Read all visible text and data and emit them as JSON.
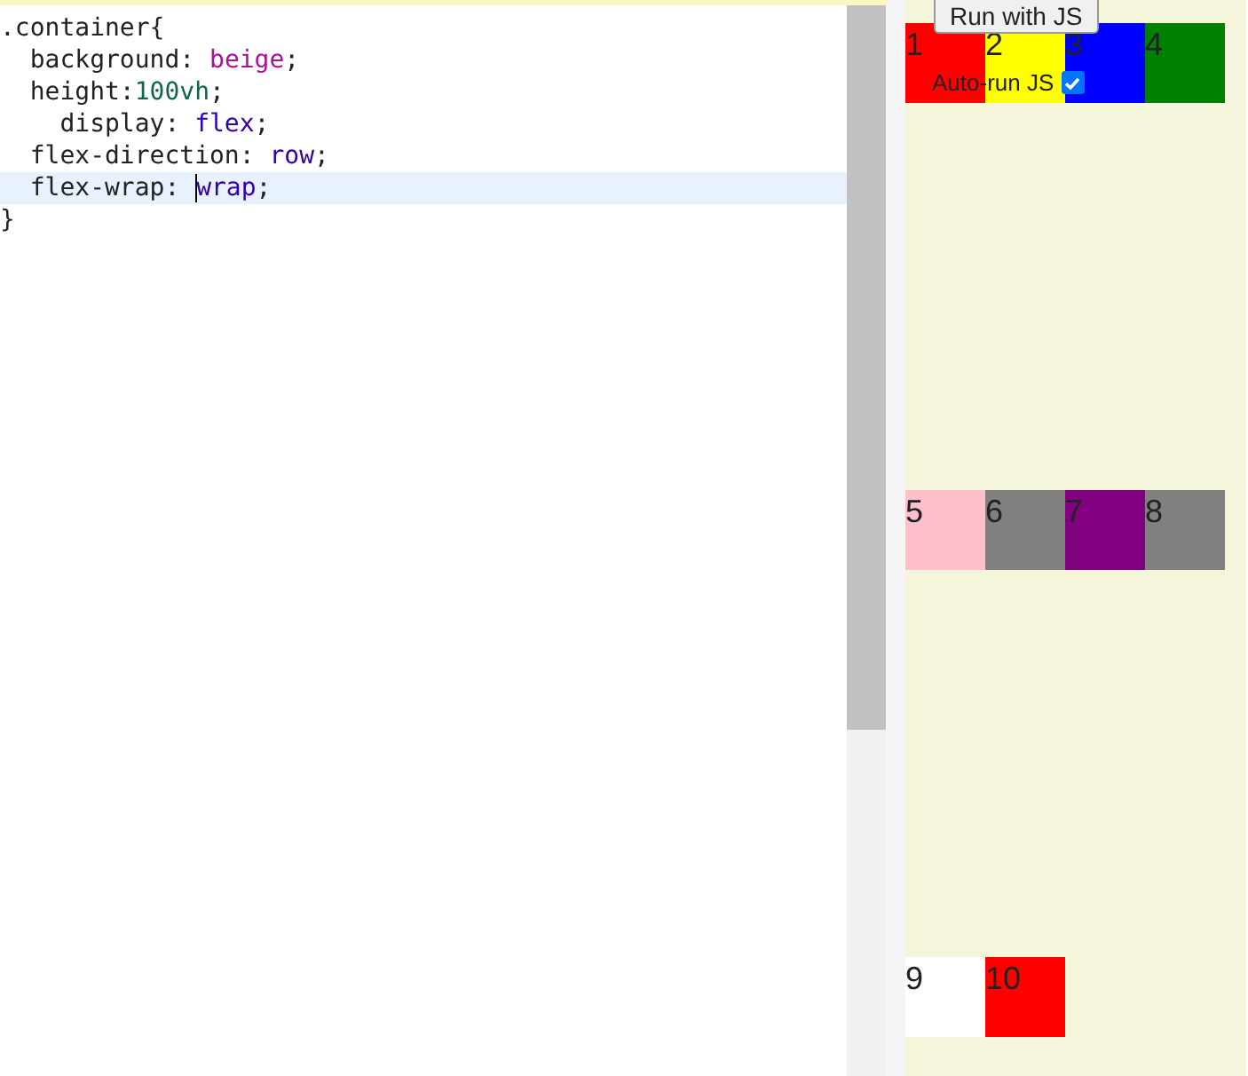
{
  "editor": {
    "lines": [
      {
        "active": false,
        "segments": [
          {
            "text": ".container{",
            "kind": "plain"
          }
        ]
      },
      {
        "active": false,
        "segments": [
          {
            "text": "  background: ",
            "kind": "plain"
          },
          {
            "text": "beige",
            "kind": "keyword"
          },
          {
            "text": ";",
            "kind": "plain"
          }
        ]
      },
      {
        "active": false,
        "segments": [
          {
            "text": "  height:",
            "kind": "plain"
          },
          {
            "text": "100vh",
            "kind": "number"
          },
          {
            "text": ";",
            "kind": "plain"
          }
        ]
      },
      {
        "active": false,
        "segments": [
          {
            "text": "    display: ",
            "kind": "plain"
          },
          {
            "text": "flex",
            "kind": "atom"
          },
          {
            "text": ";",
            "kind": "plain"
          }
        ]
      },
      {
        "active": false,
        "segments": [
          {
            "text": "  flex-direction: ",
            "kind": "plain"
          },
          {
            "text": "row",
            "kind": "atom"
          },
          {
            "text": ";",
            "kind": "plain"
          }
        ]
      },
      {
        "active": true,
        "segments": [
          {
            "text": "  flex-wrap: ",
            "kind": "plain"
          },
          {
            "text": "wrap",
            "kind": "atom",
            "caret_before": true
          },
          {
            "text": ";",
            "kind": "plain"
          }
        ]
      },
      {
        "active": false,
        "segments": [
          {
            "text": "}",
            "kind": "plain"
          }
        ]
      }
    ]
  },
  "preview": {
    "run_button": "Run with JS",
    "auto_run": {
      "label": "Auto-run JS",
      "checked": true
    },
    "boxes": [
      {
        "label": "1",
        "color": "#ff0000"
      },
      {
        "label": "2",
        "color": "#ffff00"
      },
      {
        "label": "3",
        "color": "#0000ff"
      },
      {
        "label": "4",
        "color": "#008000"
      },
      {
        "label": "5",
        "color": "#ffc0cb"
      },
      {
        "label": "6",
        "color": "#808080"
      },
      {
        "label": "7",
        "color": "#800080"
      },
      {
        "label": "8",
        "color": "#808080"
      },
      {
        "label": "9",
        "color": "#ffffff"
      },
      {
        "label": "10",
        "color": "#ff0000"
      }
    ]
  }
}
